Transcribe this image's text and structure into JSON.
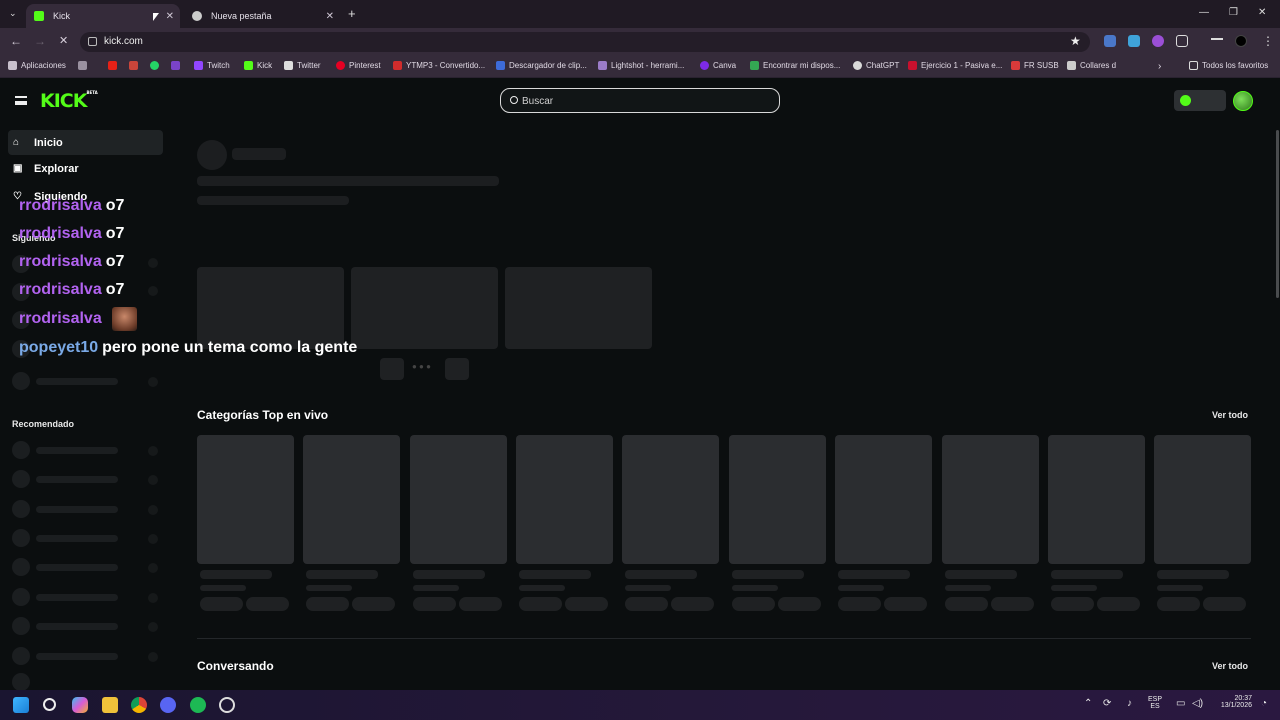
{
  "browser": {
    "tabs": [
      {
        "title": "Kick",
        "active": true
      },
      {
        "title": "Nueva pestaña",
        "active": false
      }
    ],
    "url": "kick.com",
    "bookmarks": [
      {
        "label": "Aplicaciones",
        "color": "#e0d9e4"
      },
      {
        "label": "Twitch",
        "color": "#9146ff"
      },
      {
        "label": "Kick",
        "color": "#53fc18"
      },
      {
        "label": "Twitter",
        "color": "#ffffff"
      },
      {
        "label": "Pinterest",
        "color": "#e60023"
      },
      {
        "label": "YTMP3 - Convertido...",
        "color": "#d12c2c"
      },
      {
        "label": "Descargador de clip...",
        "color": "#3d6bd9"
      },
      {
        "label": "Lightshot - herrami...",
        "color": "#9b7cc9"
      },
      {
        "label": "Canva",
        "color": "#7d2ae8"
      },
      {
        "label": "Encontrar mi dispos...",
        "color": "#34a853"
      },
      {
        "label": "ChatGPT",
        "color": "#d9d9d9"
      },
      {
        "label": "Ejercicio 1 - Pasiva e...",
        "color": "#c8102e"
      },
      {
        "label": "FR SUSB",
        "color": "#d93a3a"
      },
      {
        "label": "Collares d",
        "color": "#cccccc"
      },
      {
        "label": "Todos los favoritos",
        "color": "#e0d9e4"
      }
    ]
  },
  "kick": {
    "logo": "KICK",
    "logo_badge": "BETA",
    "search_placeholder": "Buscar",
    "brand_color": "#53fc18",
    "nav": {
      "inicio": "Inicio",
      "explorar": "Explorar",
      "siguiendo": "Siguiendo"
    },
    "sidebar_following_head": "Siguiendo",
    "sidebar_recommended_head": "Recomendado",
    "sections": {
      "top_categories": "Categorías Top en vivo",
      "conversando": "Conversando",
      "ver_todo": "Ver todo"
    }
  },
  "chat_overlay": [
    {
      "user": "rrodrisalva",
      "message": "o7",
      "user_color": "#b263f0"
    },
    {
      "user": "rrodrisalva",
      "message": "o7",
      "user_color": "#b263f0"
    },
    {
      "user": "rrodrisalva",
      "message": "o7",
      "user_color": "#b263f0"
    },
    {
      "user": "rrodrisalva",
      "message": "o7",
      "user_color": "#b263f0"
    },
    {
      "user": "rrodrisalva",
      "message": "",
      "emote": "face-emote",
      "user_color": "#b263f0"
    },
    {
      "user": "popeyet10",
      "message": "pero pone un tema como la gente",
      "user_color": "#7aa9e6"
    }
  ],
  "taskbar": {
    "lang_top": "ESP",
    "lang_bottom": "ES",
    "time": "20:37",
    "date": "13/1/2026"
  }
}
